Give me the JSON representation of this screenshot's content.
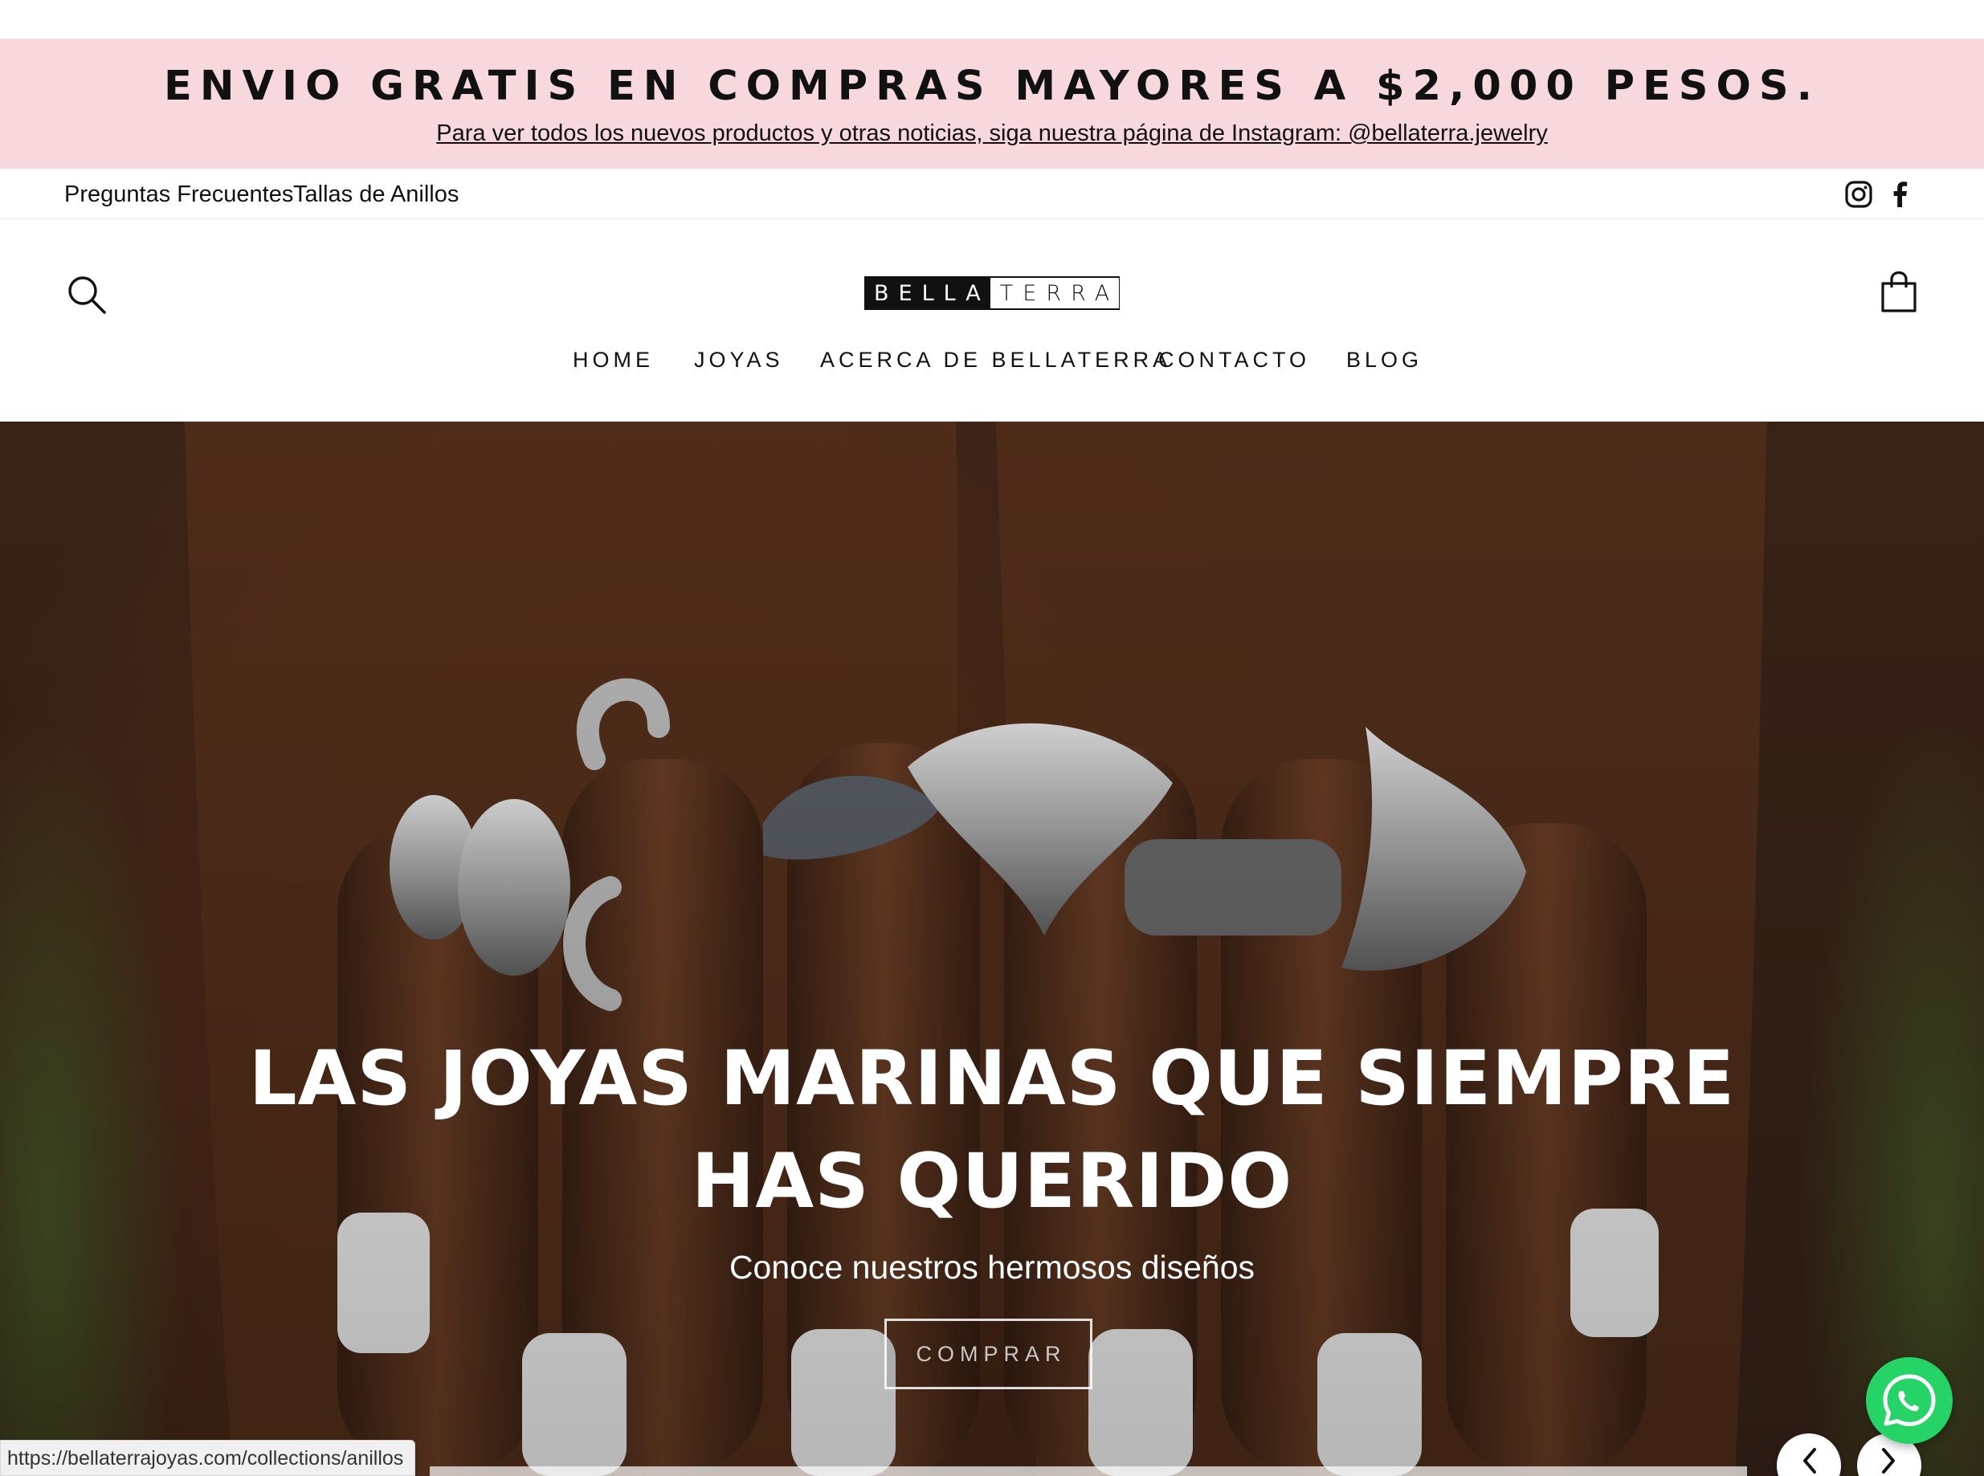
{
  "announcement": {
    "title": "ENVIO GRATIS EN COMPRAS MAYORES A $2,000 PESOS.",
    "subtitle": "Para ver todos los nuevos productos y otras noticias, siga nuestra página de Instagram: @bellaterra.jewelry",
    "background": "#f7d9dd"
  },
  "utility_bar": {
    "links": [
      "Preguntas Frecuentes",
      "Tallas de Anillos"
    ],
    "social_icons": [
      "instagram-icon",
      "facebook-icon"
    ]
  },
  "header": {
    "logo": {
      "left": "BELLA",
      "right": "TERRA"
    },
    "icons": [
      "search-icon",
      "cart-icon"
    ]
  },
  "nav": {
    "items": [
      "HOME",
      "JOYAS",
      "ACERCA DE BELLATERRA",
      "CONTACTO",
      "BLOG"
    ]
  },
  "hero": {
    "title": "LAS JOYAS MARINAS QUE SIEMPRE HAS QUERIDO",
    "subtitle": "Conoce nuestros hermosos diseños",
    "button": "COMPRAR",
    "prev_icon": "chevron-left-icon",
    "next_icon": "chevron-right-icon"
  },
  "status_bar": {
    "url": "https://bellaterrajoyas.com/collections/anillos"
  },
  "widgets": {
    "chat_icon": "whatsapp-icon",
    "chat_color": "#25d366"
  }
}
